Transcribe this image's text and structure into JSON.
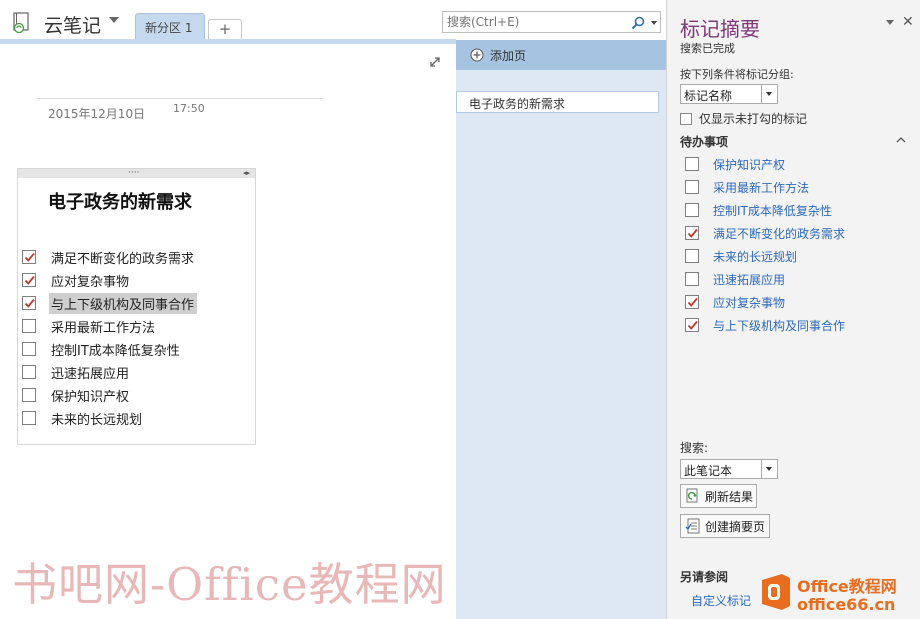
{
  "header": {
    "notebook_title": "云笔记",
    "section_tab": "新分区 1",
    "add_tab": "+",
    "search": {
      "placeholder": "搜索(Ctrl+E)"
    }
  },
  "page": {
    "date": "2015年12月10日",
    "time": "17:50",
    "title": "电子政务的新需求",
    "todos": [
      {
        "text": "满足不断变化的政务需求",
        "checked": true
      },
      {
        "text": "应对复杂事物",
        "checked": true
      },
      {
        "text": "与上下级机构及同事合作",
        "checked": true,
        "selected": true
      },
      {
        "text": "采用最新工作方法",
        "checked": false
      },
      {
        "text": "控制IT成本降低复杂性",
        "checked": false
      },
      {
        "text": "迅速拓展应用",
        "checked": false
      },
      {
        "text": "保护知识产权",
        "checked": false
      },
      {
        "text": "未来的长远规划",
        "checked": false
      }
    ]
  },
  "page_list": {
    "add_page": "添加页",
    "items": [
      "电子政务的新需求"
    ]
  },
  "tag_summary": {
    "title": "标记摘要",
    "status": "搜索已完成",
    "group_label": "按下列条件将标记分组:",
    "group_value": "标记名称",
    "show_unchecked_label": "仅显示未打勾的标记",
    "group_header": "待办事项",
    "tags": [
      {
        "text": "保护知识产权",
        "checked": false
      },
      {
        "text": "采用最新工作方法",
        "checked": false
      },
      {
        "text": "控制IT成本降低复杂性",
        "checked": false
      },
      {
        "text": "满足不断变化的政务需求",
        "checked": true
      },
      {
        "text": "未来的长远规划",
        "checked": false
      },
      {
        "text": "迅速拓展应用",
        "checked": false
      },
      {
        "text": "应对复杂事物",
        "checked": true
      },
      {
        "text": "与上下级机构及同事合作",
        "checked": true
      }
    ],
    "search_label": "搜索:",
    "search_scope": "此笔记本",
    "refresh_button": "刷新结果",
    "create_summary_button": "创建摘要页",
    "see_also": "另请参阅",
    "custom_tags_link": "自定义标记"
  },
  "watermarks": {
    "text": "书吧网-Office教程网",
    "logo_text": "Office教程网",
    "logo_sub": "office66.cn"
  },
  "colors": {
    "accent_title": "#80397b",
    "tab_blue": "#c5d9ee",
    "page_list_bg": "#dde8f4",
    "add_page_bar": "#a6c4e2",
    "check_red": "#c0392b",
    "link_blue": "#2e6ab8"
  }
}
